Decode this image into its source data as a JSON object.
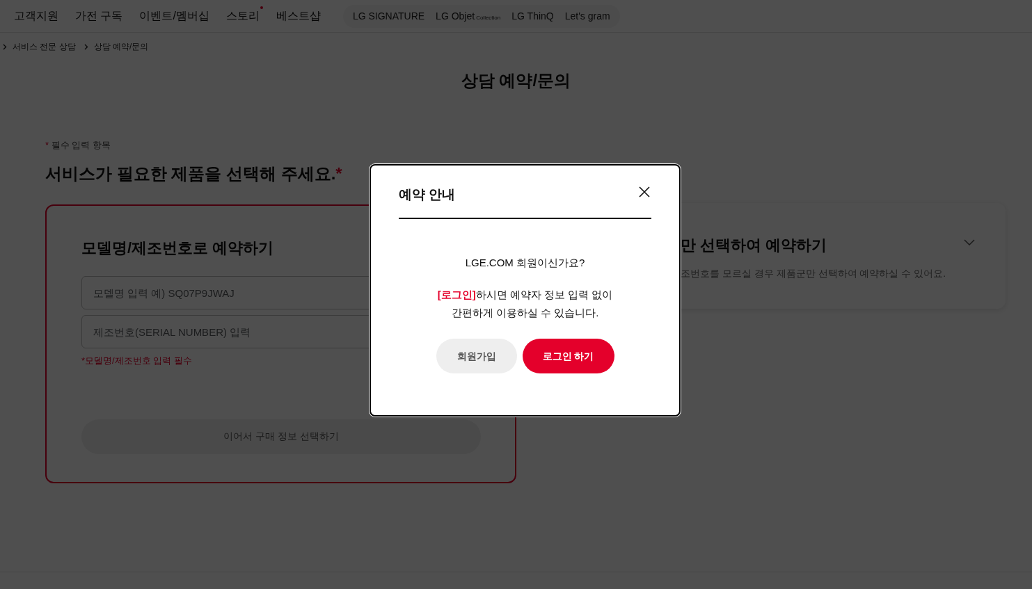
{
  "nav": {
    "items": [
      {
        "label": "고객지원",
        "new": false
      },
      {
        "label": "가전 구독",
        "new": false
      },
      {
        "label": "이벤트/멤버십",
        "new": false
      },
      {
        "label": "스토리",
        "new": true
      },
      {
        "label": "베스트샵",
        "new": false
      }
    ],
    "brands": [
      {
        "label": "LG SIGNATURE"
      },
      {
        "label": "LG Objet",
        "sub": "Collection"
      },
      {
        "label": "LG ThinQ"
      },
      {
        "label": "Let's gram"
      }
    ]
  },
  "breadcrumb": [
    "서비스 전문 상담",
    "상담 예약/문의"
  ],
  "page_title": "상담 예약/문의",
  "required_note": {
    "mark": "*",
    "text": "필수 입력 항목"
  },
  "section_title": {
    "text": "서비스가 필요한 제품을 선택해 주세요.",
    "mark": "*"
  },
  "model_card": {
    "title": "모델명/제조번호로 예약하기",
    "selected": true,
    "fields": [
      {
        "placeholder": "모델명 입력 예) SQ07P9JWAJ"
      },
      {
        "placeholder": "제조번호(SERIAL NUMBER) 입력"
      }
    ],
    "error": "*모델명/제조번호 입력 필수",
    "button": {
      "label": "이어서 구매 정보 선택하기",
      "disabled": true
    }
  },
  "product_card": {
    "title": "만 선택하여 예약하기",
    "description": "조번호를 모르실 경우 제품군만 선택하여 예약하실 수 있어요.",
    "expanded": false
  },
  "modal": {
    "title": "예약 안내",
    "question": "LGE.COM 회원이신가요?",
    "message": {
      "link": "[로그인]",
      "lines": [
        "하시면 예약자 정보 입력 없이",
        "간편하게 이용하실 수 있습니다."
      ]
    },
    "buttons": [
      {
        "label": "회원가입",
        "kind": "secondary"
      },
      {
        "label": "로그인 하기",
        "kind": "primary"
      }
    ]
  }
}
